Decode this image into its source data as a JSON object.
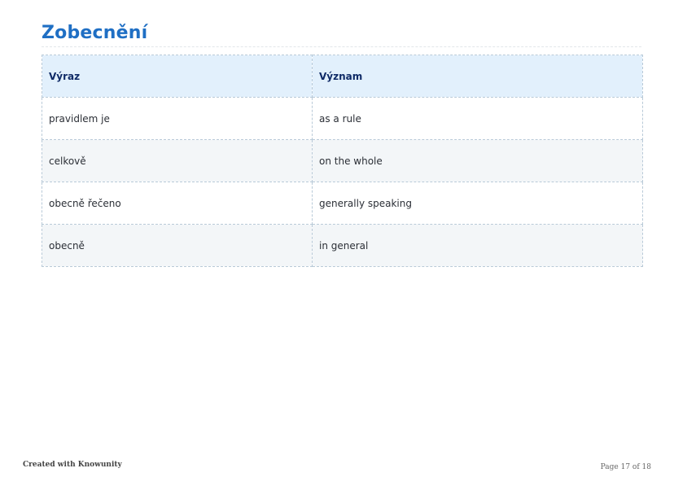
{
  "title": "Zobecnění",
  "table": {
    "headers": [
      "Výraz",
      "Význam"
    ],
    "rows": [
      [
        "pravidlem je",
        "as a rule"
      ],
      [
        "celkově",
        "on the whole"
      ],
      [
        "obecně řečeno",
        "generally speaking"
      ],
      [
        "obecně",
        "in general"
      ]
    ]
  },
  "footer": {
    "left": "Created with Knowunity",
    "right": "Page 17 of 18"
  }
}
